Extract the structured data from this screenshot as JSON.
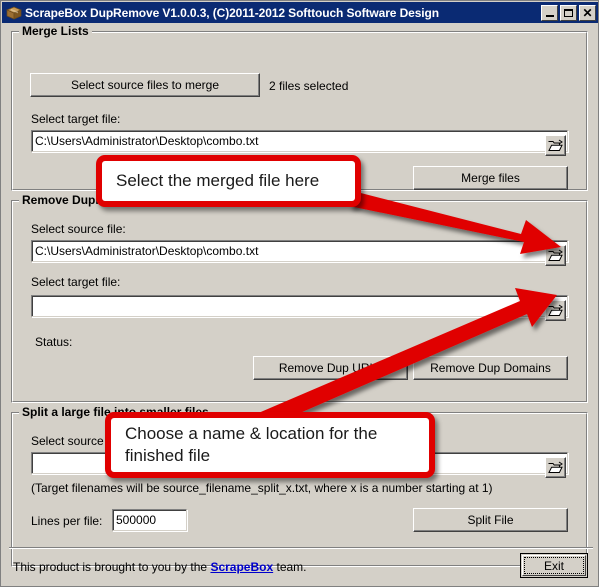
{
  "window": {
    "title": "ScrapeBox DupRemove V1.0.0.3, (C)2011-2012 Softtouch Software Design",
    "icon": "box-package-icon",
    "minimize_label": "Minimize",
    "maximize_label": "Maximize",
    "close_label": "Close"
  },
  "merge": {
    "group_title": "Merge Lists",
    "select_source_button": "Select source files to merge",
    "files_selected_status": "2 files selected",
    "target_label": "Select target file:",
    "target_value": "C:\\Users\\Administrator\\Desktop\\combo.txt",
    "browse_icon": "open-folder-icon",
    "merge_button": "Merge files"
  },
  "remove": {
    "group_title": "Remove Duplicate URLs or Domains",
    "source_label": "Select source file:",
    "source_value": "C:\\Users\\Administrator\\Desktop\\combo.txt",
    "target_label": "Select target file:",
    "target_value": "",
    "status_label": "Status:",
    "status_value": "",
    "remove_urls_button": "Remove Dup URLs",
    "remove_domains_button": "Remove Dup Domains",
    "browse_icon": "open-folder-icon"
  },
  "split": {
    "group_title": "Split a large file into smaller files",
    "source_label": "Select source file:",
    "source_value": "",
    "hint": "(Target filenames will be source_filename_split_x.txt, where x is a number starting at 1)",
    "lines_label": "Lines per file:",
    "lines_value": "500000",
    "split_button": "Split File",
    "browse_icon": "open-folder-icon"
  },
  "footer": {
    "text_before": "This product is brought to you by the ",
    "link_text": "ScrapeBox",
    "text_after": " team.",
    "exit_button": "Exit"
  },
  "annotations": {
    "callout_1": "Select the merged file here",
    "callout_2_line1": "Choose a name & location for the",
    "callout_2_line2": "finished file",
    "arrow_color": "#e00000"
  },
  "colors": {
    "titlebar": "#0a2a73",
    "face": "#d4d0c8",
    "accent_red": "#e00000",
    "link_blue": "#0000cc"
  }
}
